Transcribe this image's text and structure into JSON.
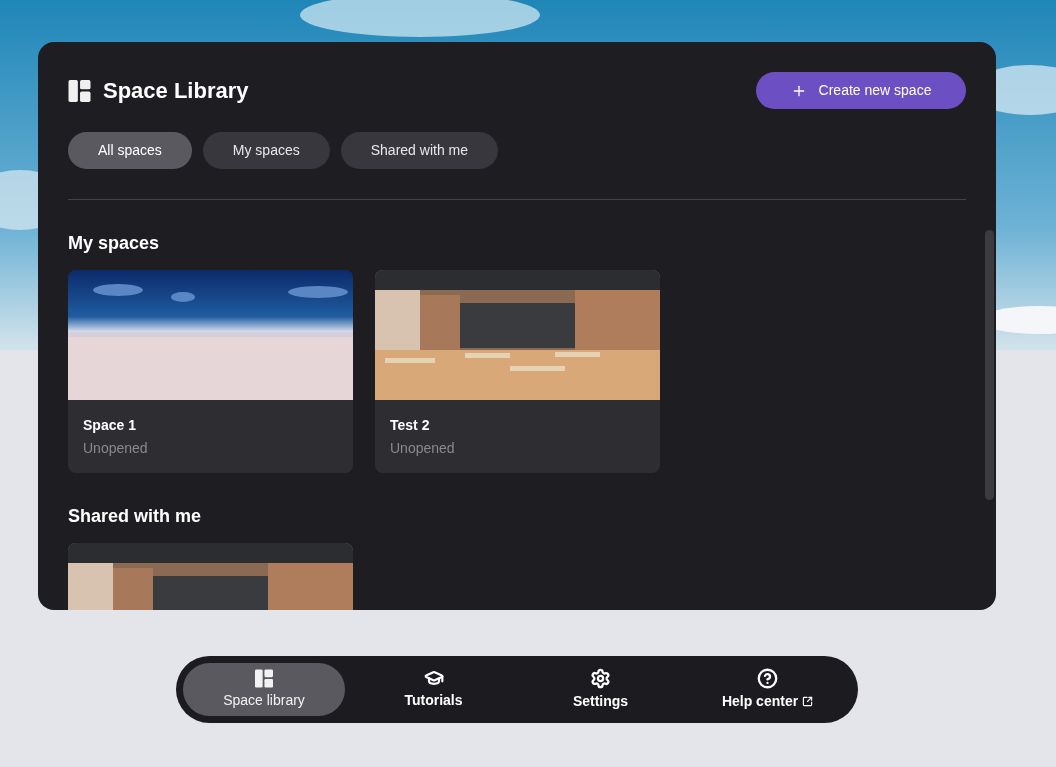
{
  "header": {
    "title": "Space Library",
    "create_button": "Create new space"
  },
  "filters": [
    {
      "label": "All spaces",
      "selected": true
    },
    {
      "label": "My spaces",
      "selected": false
    },
    {
      "label": "Shared with me",
      "selected": false
    }
  ],
  "sections": [
    {
      "title": "My spaces",
      "spaces": [
        {
          "kind": "picture",
          "name": "Space 1",
          "status": "Unopened"
        },
        {
          "kind": "picture",
          "name": "Test 2",
          "status": "Unopened"
        }
      ]
    },
    {
      "title": "Shared with me"
    }
  ],
  "nav": [
    {
      "kind": "library",
      "label": "Space library",
      "selected": true,
      "external": false
    },
    {
      "kind": "tutorials",
      "label": "Tutorials",
      "selected": false,
      "external": false
    },
    {
      "kind": "settings",
      "label": "Settings",
      "selected": false,
      "external": false
    },
    {
      "kind": "help",
      "label": "Help center",
      "selected": false,
      "external": true
    }
  ]
}
